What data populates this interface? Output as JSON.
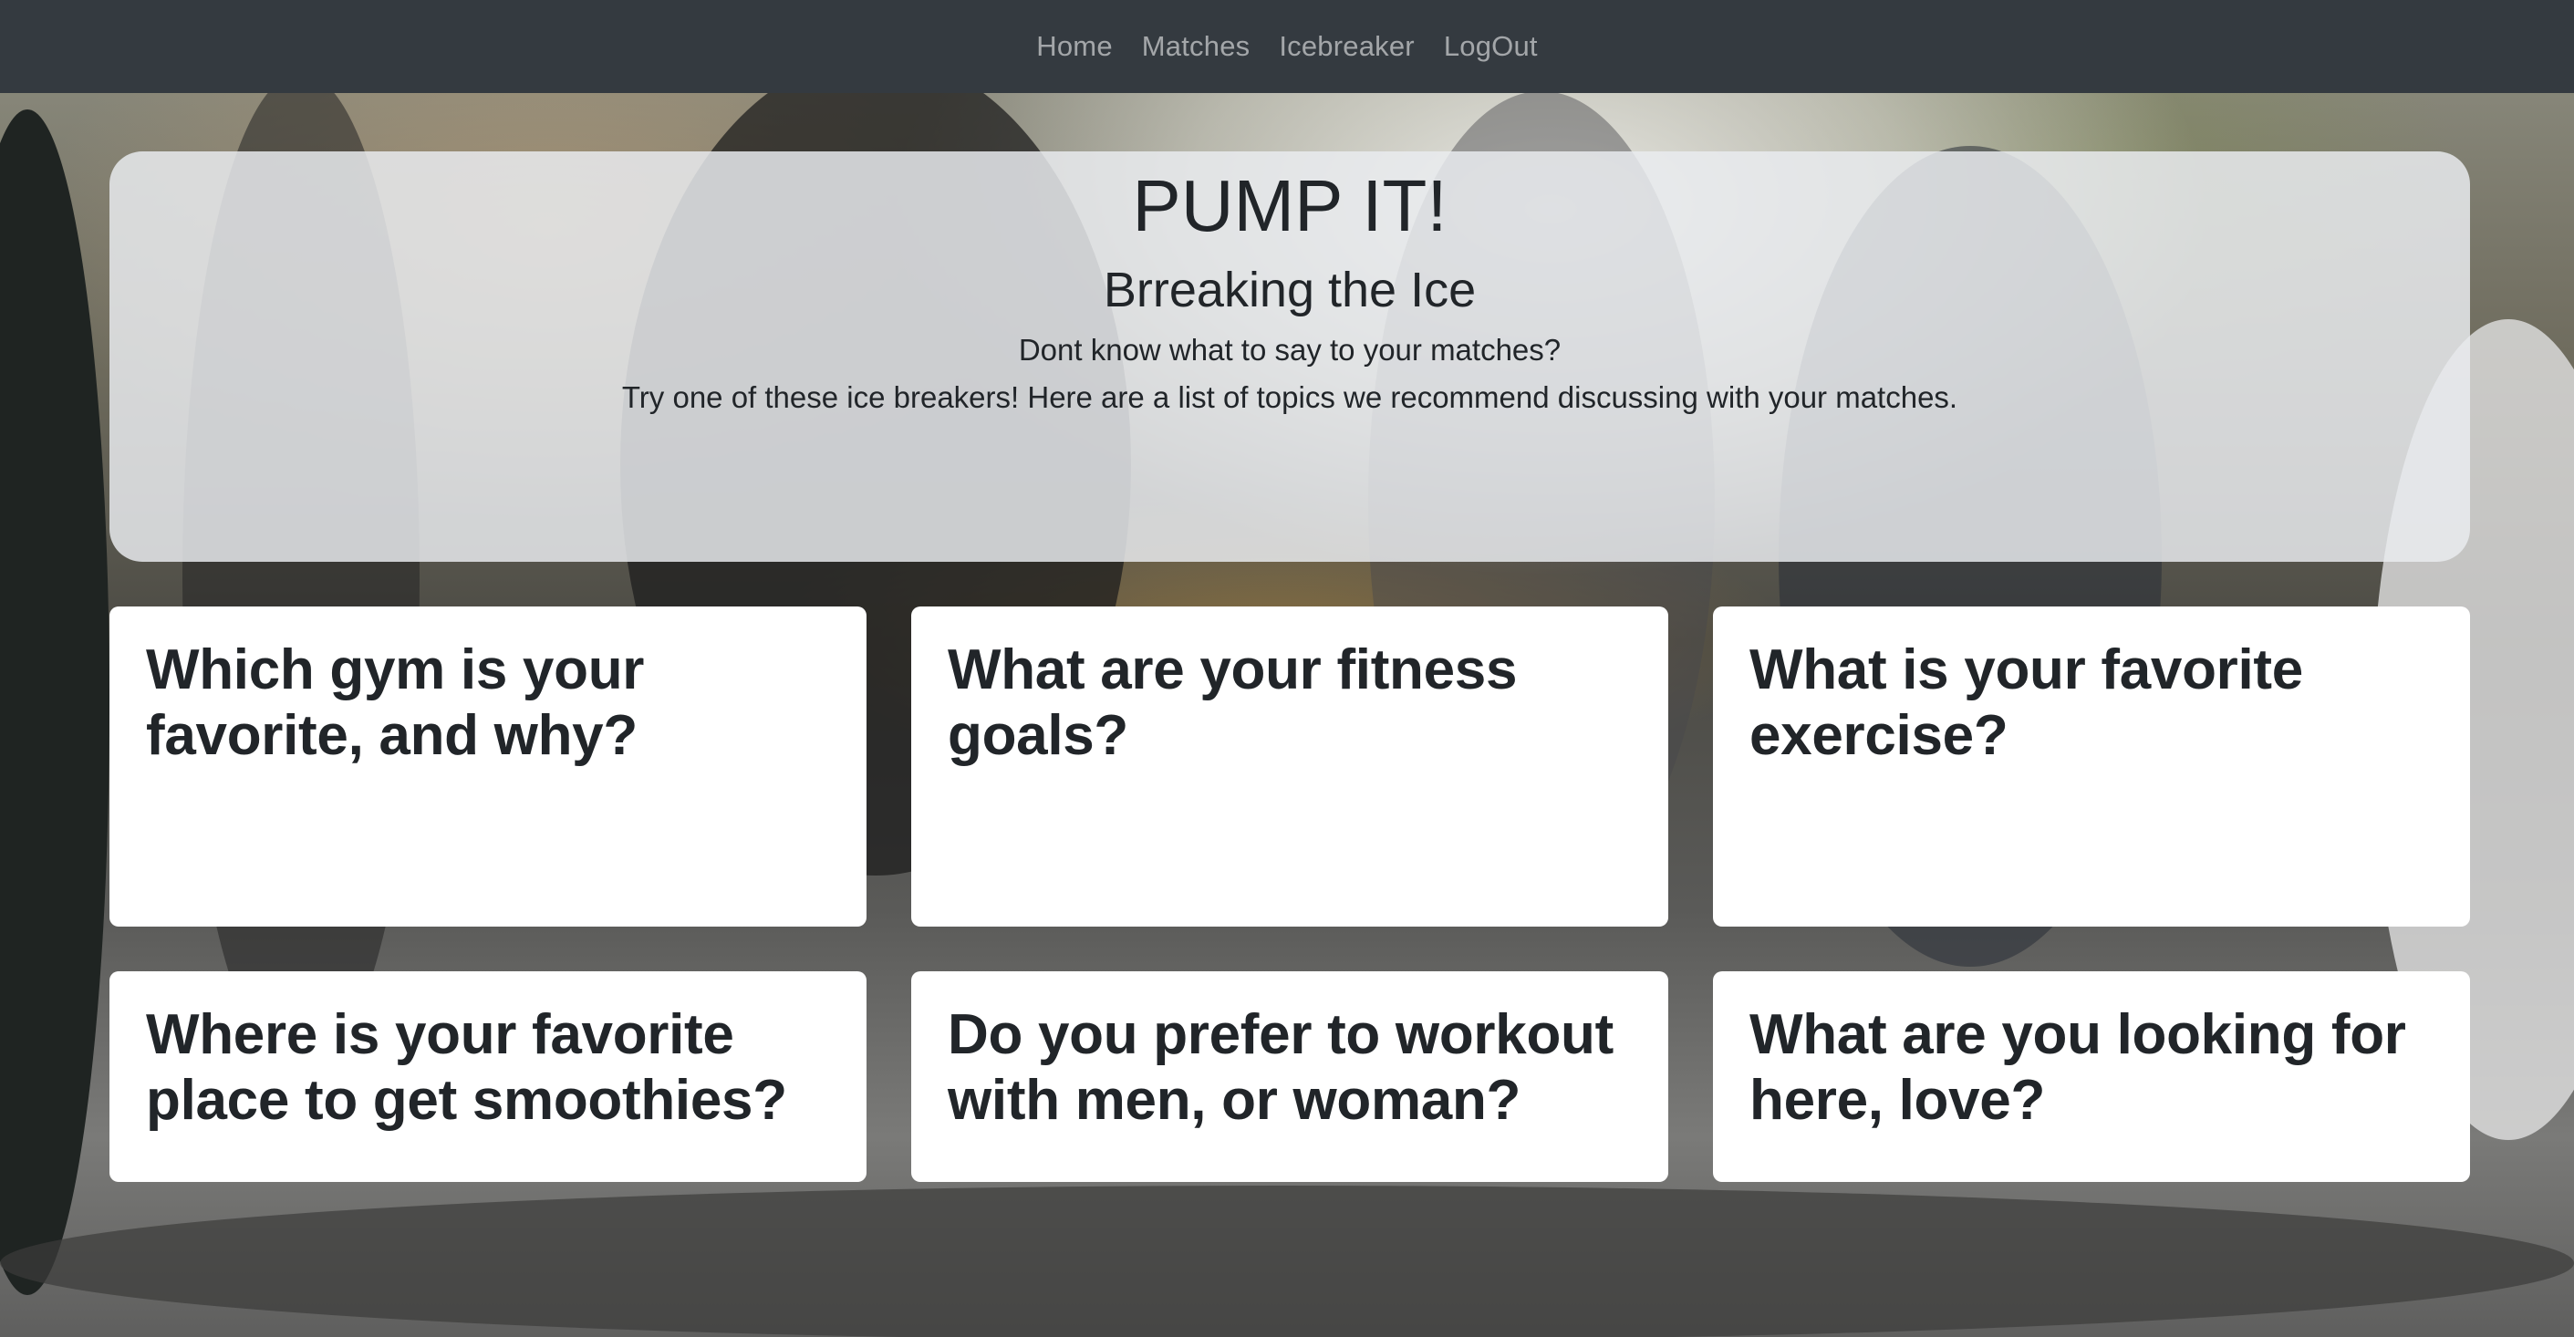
{
  "nav": {
    "items": [
      {
        "label": "Home"
      },
      {
        "label": "Matches"
      },
      {
        "label": "Icebreaker"
      },
      {
        "label": "LogOut"
      }
    ]
  },
  "hero": {
    "title": "PUMP IT!",
    "subtitle": "Brreaking the Ice",
    "line1": "Dont know what to say to your matches?",
    "line2": "Try one of these ice breakers! Here are a list of topics we recommend discussing with your matches."
  },
  "cards": [
    {
      "question": "Which gym is your favorite, and why?"
    },
    {
      "question": "What are your fitness goals?"
    },
    {
      "question": "What is your favorite exercise?"
    },
    {
      "question": "Where is your favorite place to get smoothies?"
    },
    {
      "question": "Do you prefer to workout with men, or woman?"
    },
    {
      "question": "What are you looking for here, love?"
    }
  ],
  "colors": {
    "navbar": "#343a40",
    "nav_link": "rgba(255,255,255,0.55)",
    "jumbotron": "#e9ecef",
    "card": "#ffffff",
    "text": "#212529"
  }
}
